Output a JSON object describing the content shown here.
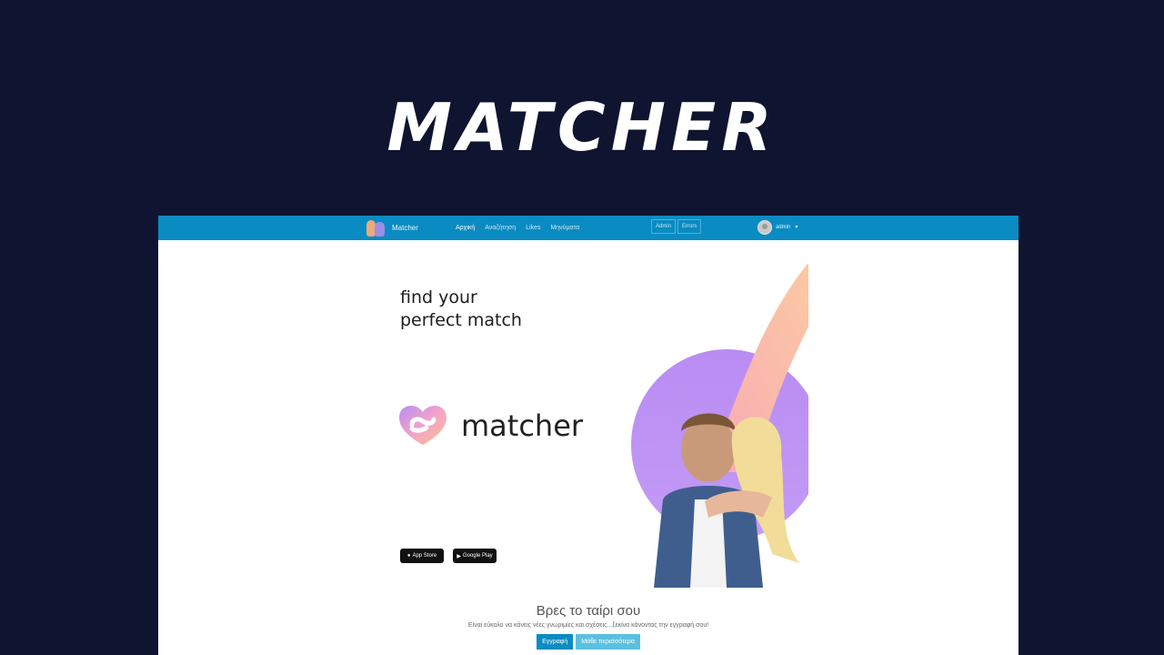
{
  "hero": {
    "title": "MATCHER"
  },
  "navbar": {
    "brand": "Matcher",
    "links": [
      "Αρχική",
      "Αναζήτηση",
      "Likes",
      "Μηνύματα"
    ],
    "admin_links": [
      "Admin",
      "Errors"
    ],
    "user": "admin"
  },
  "banner": {
    "tagline_line1": "find your",
    "tagline_line2": "perfect match",
    "logo_name": "matcher",
    "app_store": "App Store",
    "google_play": "Google Play"
  },
  "cta": {
    "title": "Βρες το ταίρι σου",
    "subtitle": "Είναι εύκολο να κάνεις νέες γνωριμίες και σχέσεις...ξεκίνα κάνοντας την εγγραφή σου!",
    "register_button": "Εγγραφή",
    "learn_more_button": "Μάθε περισσότερα"
  },
  "colors": {
    "background": "#0f1430",
    "navbar": "#0a8bc1",
    "primary_button": "#0a8bc1",
    "info_button": "#5bc0de",
    "accent_gradient_start": "#f6b2a0",
    "accent_gradient_end": "#b88cf5"
  }
}
